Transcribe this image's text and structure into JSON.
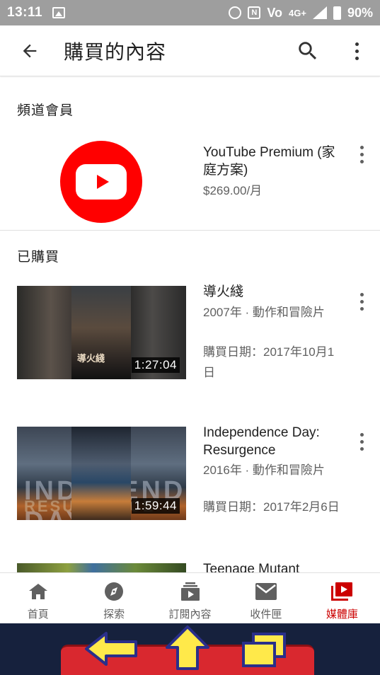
{
  "status_bar": {
    "time": "13:11",
    "network": "4G+",
    "battery": "90%"
  },
  "app_bar": {
    "title": "購買的內容",
    "back_icon": "arrow-back-icon",
    "search_icon": "search-icon",
    "more_icon": "more-vert-icon"
  },
  "sections": {
    "membership_title": "頻道會員",
    "purchased_title": "已購買"
  },
  "membership": {
    "name": "YouTube Premium (家庭方案)",
    "price": "$269.00/月",
    "logo_icon": "youtube-play-icon",
    "accent": "#ff0000"
  },
  "purchases": [
    {
      "title": "導火綫",
      "meta": "2007年 · 動作和冒險片",
      "date": "購買日期：2017年10月1日",
      "duration": "1:27:04"
    },
    {
      "title": "Independence Day: Resurgence",
      "meta": "2016年 · 動作和冒險片",
      "date": "購買日期：2017年2月6日",
      "duration": "1:59:44",
      "thumb_text": "INDEPENDENCE DAY",
      "thumb_text_2": "RESURGENCE"
    },
    {
      "title": "Teenage Mutant"
    }
  ],
  "bottom_nav": {
    "items": [
      {
        "label": "首頁",
        "icon": "home-icon"
      },
      {
        "label": "探索",
        "icon": "explore-compass-icon"
      },
      {
        "label": "訂閱內容",
        "icon": "subscriptions-icon"
      },
      {
        "label": "收件匣",
        "icon": "inbox-mail-icon"
      },
      {
        "label": "媒體庫",
        "icon": "library-icon",
        "active": true
      }
    ],
    "active_color": "#cc0000"
  },
  "system_nav": {
    "back_icon": "back-arrow-icon",
    "home_icon": "home-up-arrow-icon",
    "recents_icon": "recents-windows-icon"
  }
}
